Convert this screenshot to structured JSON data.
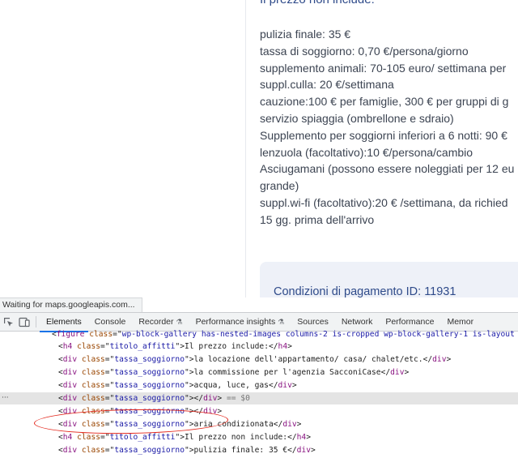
{
  "page": {
    "heading_partial": "Il prezzo non include:",
    "lines": [
      "pulizia finale: 35 €",
      "tassa di soggiorno: 0,70 €/persona/giorno",
      "supplemento animali: 70-105 euro/ settimana per",
      "suppl.culla: 20 €/settimana",
      "cauzione:100 € per famiglie, 300 € per gruppi di g",
      "servizio spiaggia (ombrellone e sdraio)",
      "Supplemento per soggiorni inferiori a 6 notti: 90 €",
      "lenzuola (facoltativo):10 €/persona/cambio",
      "Asciugamani (possono essere noleggiati per 12 eu",
      "grande)",
      "suppl.wi-fi (facoltativo):20 € /settimana, da richied",
      "15 gg. prima dell'arrivo"
    ],
    "payment_title": "Condizioni di pagamento ID: 11931"
  },
  "status_text": "Waiting for maps.googleapis.com...",
  "devtools": {
    "tabs": [
      {
        "label": "Elements",
        "active": true
      },
      {
        "label": "Console"
      },
      {
        "label": "Recorder",
        "flask": true
      },
      {
        "label": "Performance insights",
        "flask": true
      },
      {
        "label": "Sources"
      },
      {
        "label": "Network"
      },
      {
        "label": "Performance"
      },
      {
        "label": "Memor"
      }
    ],
    "flask_glyph": "⚗",
    "dots": "···",
    "rows": [
      {
        "indent": 1,
        "parts": [
          [
            "p",
            "<"
          ],
          [
            "t",
            "figure"
          ],
          [
            "p",
            " "
          ],
          [
            "a",
            "class"
          ],
          [
            "p",
            "=\""
          ],
          [
            "v",
            "wp-block-gallery has-nested-images columns-2 is-cropped wp-block-gallery-1 is-layout"
          ]
        ]
      },
      {
        "indent": 2,
        "parts": [
          [
            "p",
            "<"
          ],
          [
            "t",
            "h4"
          ],
          [
            "p",
            " "
          ],
          [
            "a",
            "class"
          ],
          [
            "p",
            "=\""
          ],
          [
            "v",
            "titolo_affitti"
          ],
          [
            "p",
            "\">"
          ],
          [
            "x",
            "Il prezzo include:"
          ],
          [
            "p",
            "</"
          ],
          [
            "t",
            "h4"
          ],
          [
            "p",
            ">"
          ]
        ]
      },
      {
        "indent": 2,
        "parts": [
          [
            "p",
            "<"
          ],
          [
            "t",
            "div"
          ],
          [
            "p",
            " "
          ],
          [
            "a",
            "class"
          ],
          [
            "p",
            "=\""
          ],
          [
            "v",
            "tassa_soggiorno"
          ],
          [
            "p",
            "\">"
          ],
          [
            "x",
            "la locazione dell'appartamento/ casa/ chalet/etc."
          ],
          [
            "p",
            "</"
          ],
          [
            "t",
            "div"
          ],
          [
            "p",
            ">"
          ]
        ]
      },
      {
        "indent": 2,
        "parts": [
          [
            "p",
            "<"
          ],
          [
            "t",
            "div"
          ],
          [
            "p",
            " "
          ],
          [
            "a",
            "class"
          ],
          [
            "p",
            "=\""
          ],
          [
            "v",
            "tassa_soggiorno"
          ],
          [
            "p",
            "\">"
          ],
          [
            "x",
            "la commissione per l'agenzia SacconiCase"
          ],
          [
            "p",
            "</"
          ],
          [
            "t",
            "div"
          ],
          [
            "p",
            ">"
          ]
        ]
      },
      {
        "indent": 2,
        "parts": [
          [
            "p",
            "<"
          ],
          [
            "t",
            "div"
          ],
          [
            "p",
            " "
          ],
          [
            "a",
            "class"
          ],
          [
            "p",
            "=\""
          ],
          [
            "v",
            "tassa_soggiorno"
          ],
          [
            "p",
            "\">"
          ],
          [
            "x",
            "acqua, luce, gas"
          ],
          [
            "p",
            "</"
          ],
          [
            "t",
            "div"
          ],
          [
            "p",
            ">"
          ]
        ]
      },
      {
        "indent": 2,
        "selected": true,
        "parts": [
          [
            "p",
            "<"
          ],
          [
            "t",
            "div"
          ],
          [
            "p",
            " "
          ],
          [
            "a",
            "class"
          ],
          [
            "p",
            "=\""
          ],
          [
            "v",
            "tassa_soggiorno"
          ],
          [
            "p",
            "\"></"
          ],
          [
            "t",
            "div"
          ],
          [
            "p",
            ">"
          ],
          [
            "z",
            " == $0"
          ]
        ]
      },
      {
        "indent": 2,
        "parts": [
          [
            "p",
            "<"
          ],
          [
            "t",
            "div"
          ],
          [
            "p",
            " "
          ],
          [
            "a",
            "class"
          ],
          [
            "p",
            "=\""
          ],
          [
            "v",
            "tassa_soggiorno"
          ],
          [
            "p",
            "\"></"
          ],
          [
            "t",
            "div"
          ],
          [
            "p",
            ">"
          ]
        ]
      },
      {
        "indent": 2,
        "parts": [
          [
            "p",
            "<"
          ],
          [
            "t",
            "div"
          ],
          [
            "p",
            " "
          ],
          [
            "a",
            "class"
          ],
          [
            "p",
            "=\""
          ],
          [
            "v",
            "tassa_soggiorno"
          ],
          [
            "p",
            "\">"
          ],
          [
            "x",
            "aria condizionata"
          ],
          [
            "p",
            "</"
          ],
          [
            "t",
            "div"
          ],
          [
            "p",
            ">"
          ]
        ]
      },
      {
        "indent": 2,
        "parts": [
          [
            "p",
            "<"
          ],
          [
            "t",
            "h4"
          ],
          [
            "p",
            " "
          ],
          [
            "a",
            "class"
          ],
          [
            "p",
            "=\""
          ],
          [
            "v",
            "titolo_affitti"
          ],
          [
            "p",
            "\">"
          ],
          [
            "x",
            "Il prezzo non include:"
          ],
          [
            "p",
            "</"
          ],
          [
            "t",
            "h4"
          ],
          [
            "p",
            ">"
          ]
        ]
      },
      {
        "indent": 2,
        "parts": [
          [
            "p",
            "<"
          ],
          [
            "t",
            "div"
          ],
          [
            "p",
            " "
          ],
          [
            "a",
            "class"
          ],
          [
            "p",
            "=\""
          ],
          [
            "v",
            "tassa_soggiorno"
          ],
          [
            "p",
            "\">"
          ],
          [
            "x",
            "pulizia finale: 35 €"
          ],
          [
            "p",
            "</"
          ],
          [
            "t",
            "div"
          ],
          [
            "p",
            ">"
          ]
        ]
      }
    ]
  },
  "colors": {
    "heading": "#2f4b8a",
    "body_text": "#3c4452",
    "tag": "#881280",
    "attribute": "#994500",
    "attribute_value": "#1a1aa6",
    "active_tab_underline": "#1a73e8",
    "annotation_circle": "#e3261b"
  }
}
